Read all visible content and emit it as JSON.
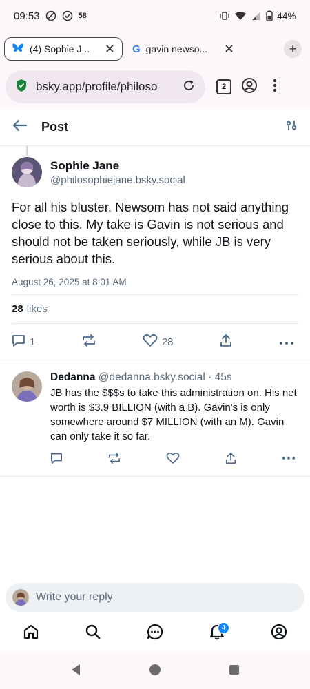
{
  "status_bar": {
    "time": "09:53",
    "temp": "58",
    "battery": "44%"
  },
  "tabs": [
    {
      "title": "(4) Sophie J...",
      "icon": "bluesky-butterfly-icon",
      "active": true
    },
    {
      "title": "gavin newso...",
      "icon": "google-g-icon",
      "active": false
    }
  ],
  "browser": {
    "url": "bsky.app/profile/philoso",
    "tab_count": "2"
  },
  "header": {
    "title": "Post"
  },
  "post": {
    "author_name": "Sophie Jane",
    "author_handle": "@philosophiejane.bsky.social",
    "text": "For all his bluster, Newsom has not said anything close to this. My take is Gavin is not serious and should not be taken seriously, while JB is very serious about this.",
    "date": "August 26, 2025 at 8:01 AM",
    "likes_count": "28",
    "likes_label": "likes",
    "reply_count": "1",
    "like_count_action": "28"
  },
  "reply": {
    "author_name": "Dedanna",
    "author_handle": "@dedanna.bsky.social",
    "time": "· 45s",
    "text": "JB has the $$$s to take this administration on. His net worth is $3.9 BILLION (with a B). Gavin's is only somewhere around $7 MILLION (with an M). Gavin can only take it so far."
  },
  "composer": {
    "placeholder": "Write your reply"
  },
  "bottom_nav": {
    "notifications_badge": "4"
  },
  "colors": {
    "accent": "#1083fe",
    "muted_text": "#5b6b7c",
    "icon_blue": "#4b6a8f"
  }
}
